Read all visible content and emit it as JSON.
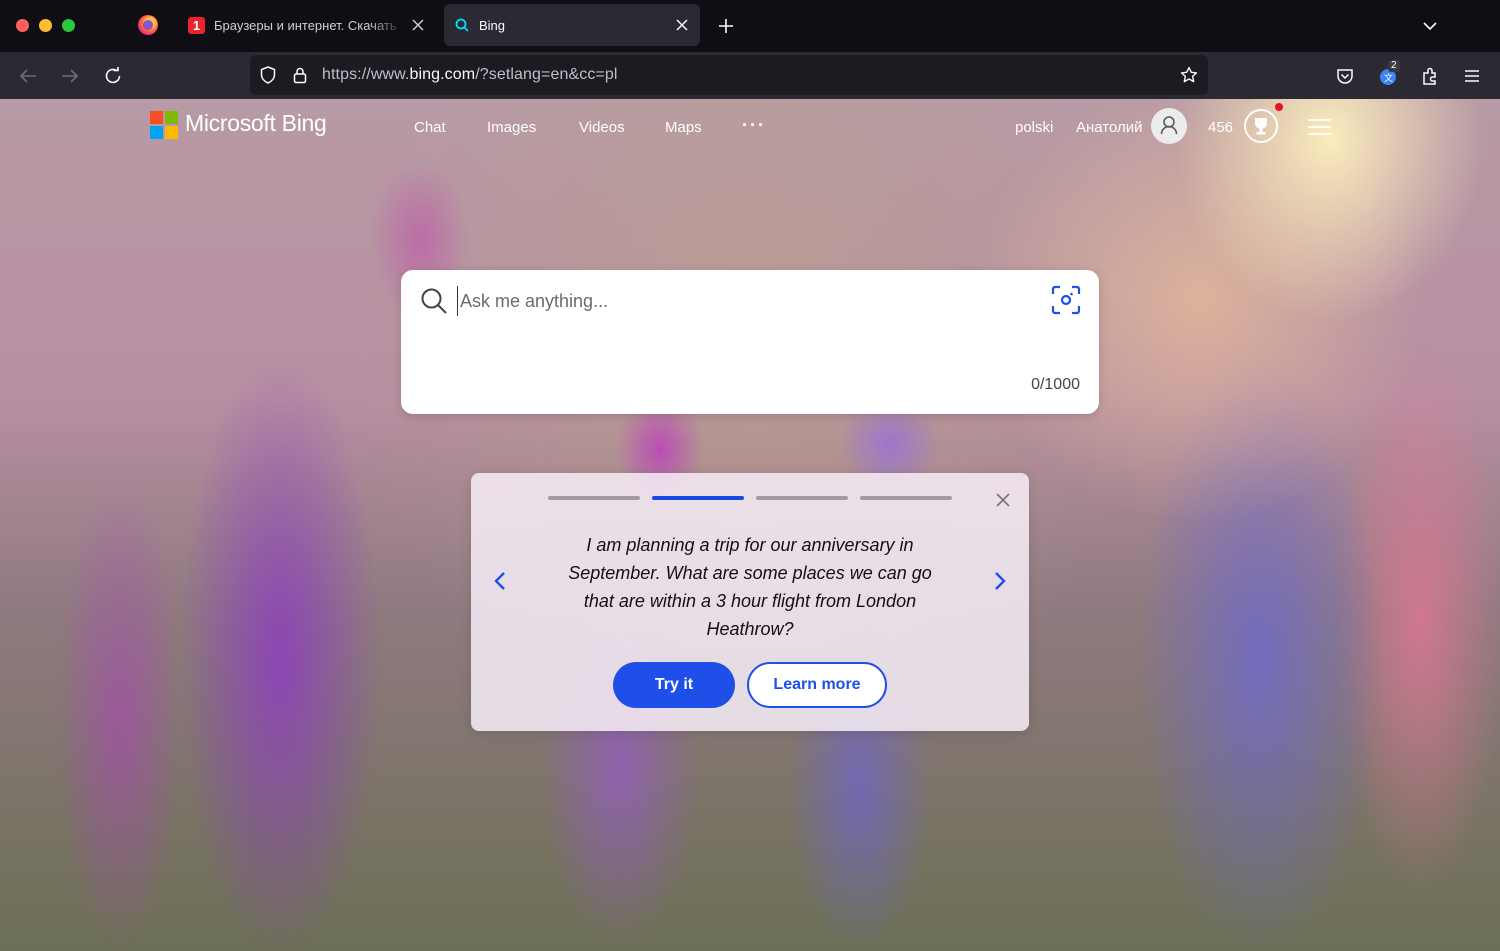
{
  "browser": {
    "tabs": [
      {
        "favicon": "1",
        "title": "Браузеры и интернет. Скачать"
      },
      {
        "title": "Bing"
      }
    ],
    "url": {
      "prefix": "https://www.",
      "domain": "bing.com",
      "suffix": "/?setlang=en&cc=pl"
    },
    "extension_badge": "2"
  },
  "bing": {
    "brand": "Microsoft Bing",
    "nav": {
      "chat": "Chat",
      "images": "Images",
      "videos": "Videos",
      "maps": "Maps",
      "more": "···"
    },
    "language": "polski",
    "user_name": "Анатолий",
    "points": "456",
    "search": {
      "placeholder": "Ask me anything...",
      "counter": "0/1000"
    },
    "suggestion": {
      "text": "I am planning a trip for our anniversary in September. What are some places we can go that are within a 3 hour flight from London Heathrow?",
      "try_label": "Try it",
      "learn_label": "Learn more",
      "steps_total": 4,
      "active_step": 2
    }
  },
  "colors": {
    "accent": "#1e4fe8",
    "chrome_dark": "#2b2a33"
  }
}
